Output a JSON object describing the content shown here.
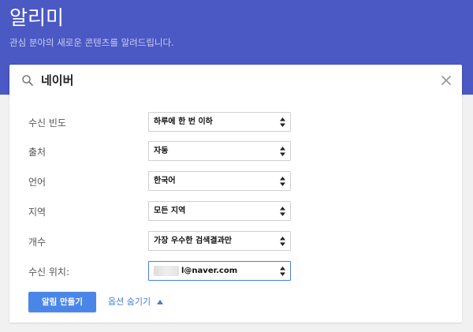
{
  "app": {
    "title": "알리미",
    "subtitle": "관심 분야의 새로운 콘텐츠를 알려드립니다."
  },
  "search": {
    "query": "네이버",
    "icon": "search-icon",
    "clear_icon": "close-icon"
  },
  "options": {
    "frequency": {
      "label": "수신 빈도",
      "value": "하루에 한 번 이하"
    },
    "sources": {
      "label": "출처",
      "value": "자동"
    },
    "language": {
      "label": "언어",
      "value": "한국어"
    },
    "region": {
      "label": "지역",
      "value": "모든 지역"
    },
    "count": {
      "label": "개수",
      "value": "가장 우수한 검색결과만"
    },
    "deliver_to": {
      "label": "수신 위치:",
      "value": "l@naver.com"
    }
  },
  "actions": {
    "create_label": "알림 만들기",
    "hide_options_label": "옵션 숨기기"
  },
  "colors": {
    "header": "#4b59c4",
    "button": "#4a86e8",
    "link": "#4a7bd8"
  }
}
